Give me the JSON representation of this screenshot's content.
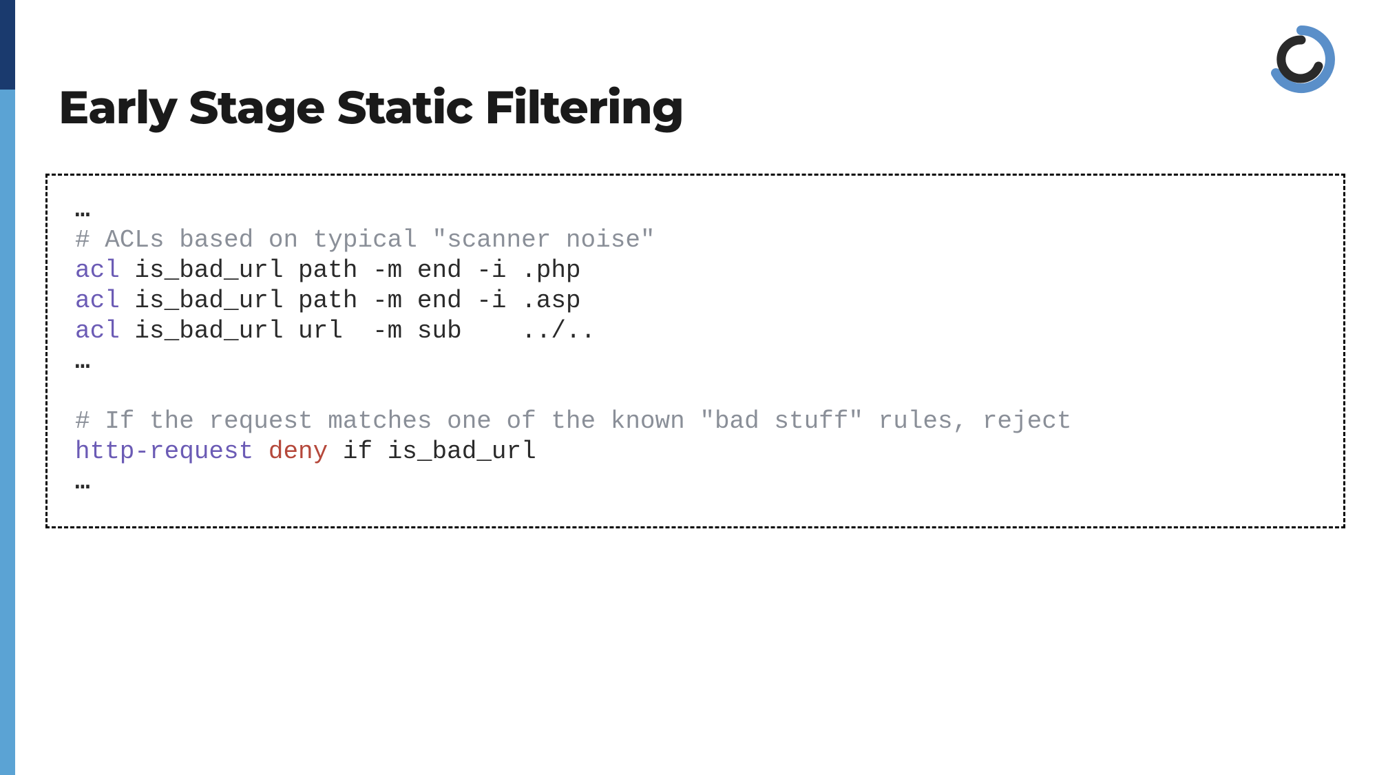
{
  "title": "Early Stage Static Filtering",
  "code": {
    "l0": "…",
    "l1": "# ACLs based on typical \"scanner noise\"",
    "l2_kw": "acl",
    "l2_rest": " is_bad_url path -m end -i .php",
    "l3_kw": "acl",
    "l3_rest": " is_bad_url path -m end -i .asp",
    "l4_kw": "acl",
    "l4_rest": " is_bad_url url  -m sub    ../..",
    "l5": "…",
    "blank": "",
    "l6": "# If the request matches one of the known \"bad stuff\" rules, reject",
    "l7_kw": "http-request",
    "l7_deny": " deny",
    "l7_rest": " if is_bad_url",
    "l8": "…"
  }
}
